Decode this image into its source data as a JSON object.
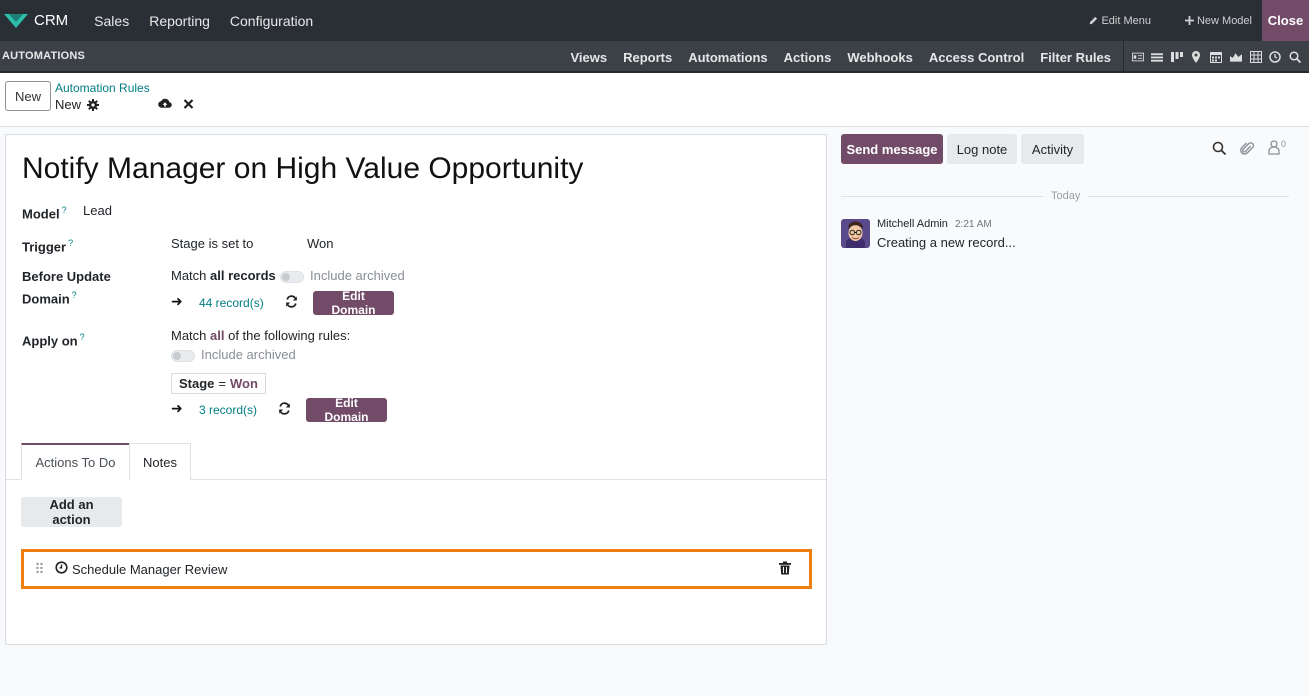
{
  "topbar": {
    "app_name": "CRM",
    "menus": [
      "Sales",
      "Reporting",
      "Configuration"
    ],
    "edit_menu": "Edit Menu",
    "new_model": "New Model",
    "close": "Close"
  },
  "studiobar": {
    "title": "AUTOMATIONS",
    "tabs": [
      "Views",
      "Reports",
      "Automations",
      "Actions",
      "Webhooks",
      "Access Control",
      "Filter Rules"
    ],
    "view_icons": [
      "form-view-icon",
      "list-view-icon",
      "kanban-view-icon",
      "map-view-icon",
      "calendar-view-icon",
      "graph-view-icon",
      "pivot-view-icon",
      "activity-view-icon",
      "search-view-icon"
    ]
  },
  "control": {
    "new_label": "New",
    "breadcrumb_parent": "Automation Rules",
    "breadcrumb_current": "New"
  },
  "form": {
    "title": "Notify Manager on High Value Opportunity",
    "model_label": "Model",
    "model_value": "Lead",
    "help_mark": "?",
    "trigger_label": "Trigger",
    "trigger_value": "Stage is set to",
    "trigger_stage": "Won",
    "before_label_1": "Before Update",
    "before_label_2": "Domain",
    "before_match_prefix": "Match ",
    "before_match_bold": "all records",
    "include_archived": "Include archived",
    "before_count": "44 record(s)",
    "edit_domain": "Edit Domain",
    "apply_label": "Apply on",
    "apply_match_prefix": "Match ",
    "apply_match_bold": "all",
    "apply_match_suffix": " of the following rules:",
    "chip_field": "Stage",
    "chip_op": "=",
    "chip_value": "Won",
    "apply_count": "3 record(s)"
  },
  "tabs": {
    "actions": "Actions To Do",
    "notes": "Notes"
  },
  "actions": {
    "add_label": "Add an action",
    "items": [
      {
        "label": "Schedule Manager Review"
      }
    ]
  },
  "chatter": {
    "send_message": "Send message",
    "log_note": "Log note",
    "activity": "Activity",
    "followers_count": "0",
    "date_separator": "Today",
    "author": "Mitchell Admin",
    "time": "2:21 AM",
    "message": "Creating a new record..."
  },
  "colors": {
    "brand": "#714b67",
    "teal": "#017e84",
    "highlight": "#f07f13",
    "topbar": "#2a2f36"
  }
}
